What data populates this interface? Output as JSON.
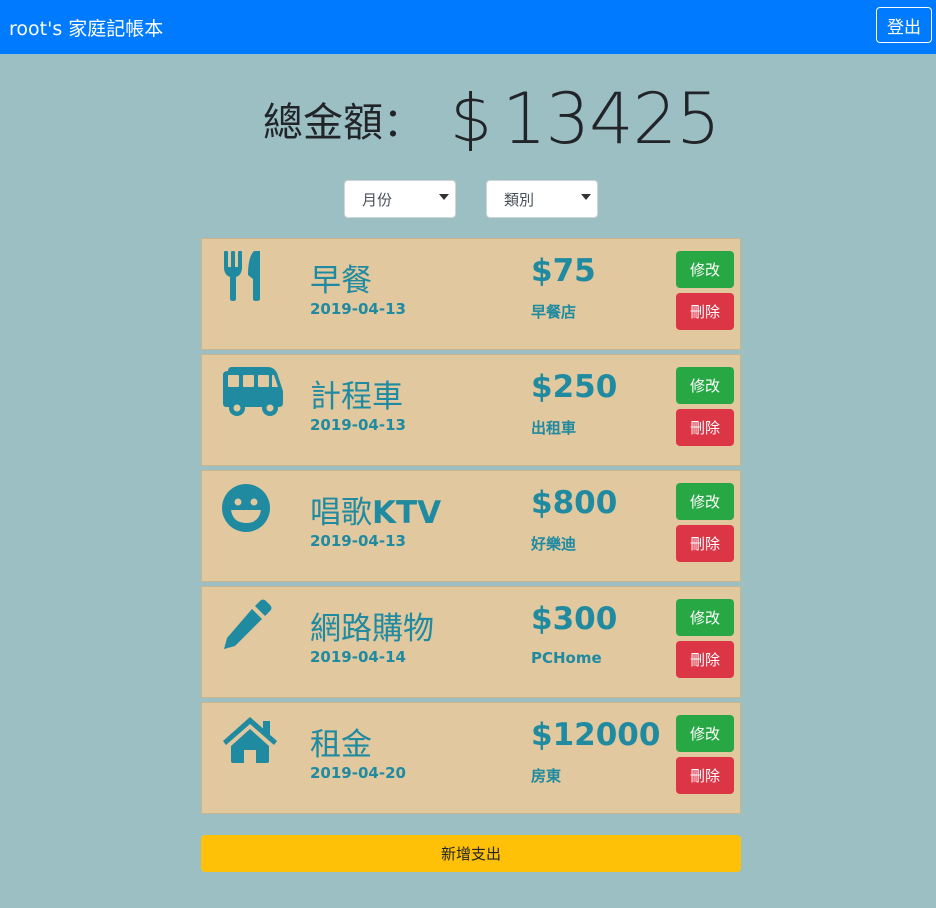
{
  "navbar": {
    "brand": "root's 家庭記帳本",
    "logout_label": "登出",
    "color": "#007bff"
  },
  "total": {
    "label": "總金額：",
    "currency": "$",
    "amount": "13425"
  },
  "filters": {
    "month": "月份",
    "category": "類別"
  },
  "expenses": [
    {
      "icon": "utensils-icon",
      "title": "早餐",
      "date": "2019-04-13",
      "amount": "$75",
      "place": "早餐店"
    },
    {
      "icon": "bus-icon",
      "title": "計程車",
      "date": "2019-04-13",
      "amount": "$250",
      "place": "出租車"
    },
    {
      "icon": "grin-icon",
      "title_main": "唱歌",
      "title_suffix": "KTV",
      "date": "2019-04-13",
      "amount": "$800",
      "place": "好樂迪"
    },
    {
      "icon": "pencil-icon",
      "title": "網路購物",
      "date": "2019-04-14",
      "amount": "$300",
      "place": "PCHome"
    },
    {
      "icon": "home-icon",
      "title": "租金",
      "date": "2019-04-20",
      "amount": "$12000",
      "place": "房東"
    }
  ],
  "actions": {
    "edit_label": "修改",
    "delete_label": "刪除",
    "add_label": "新增支出"
  },
  "colors": {
    "background": "#9cbfc4",
    "card": "#e1c89e",
    "accent": "#1f8aa0",
    "edit": "#28a745",
    "delete": "#dc3545",
    "add": "#ffc107"
  }
}
